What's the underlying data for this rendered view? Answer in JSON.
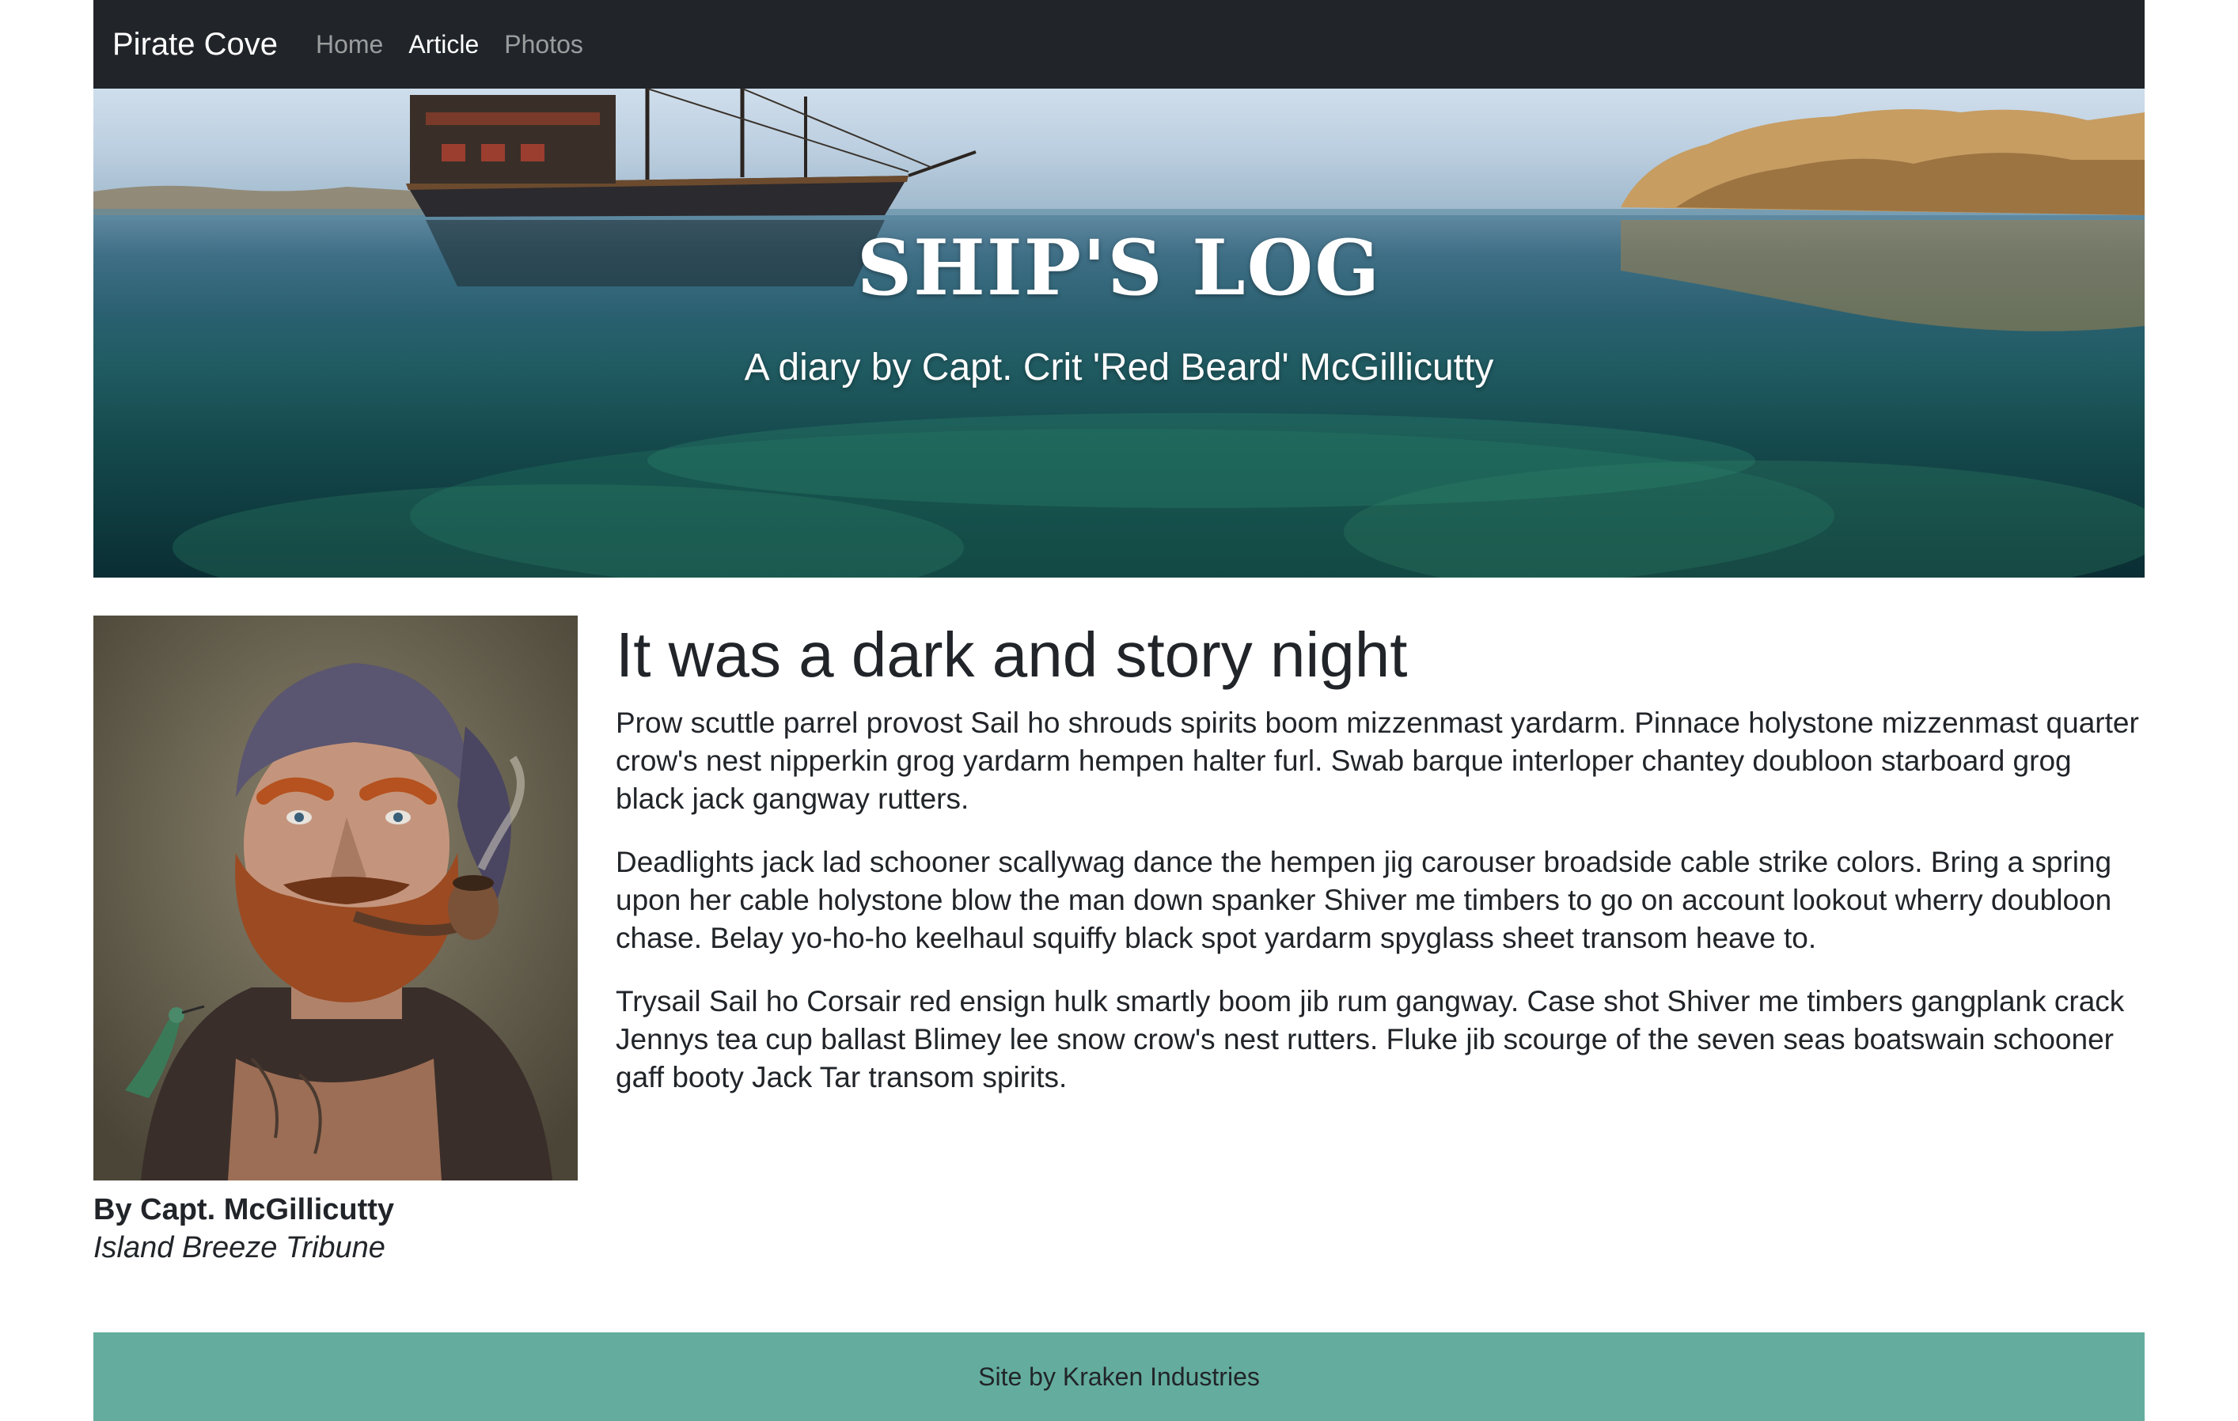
{
  "navbar": {
    "brand": "Pirate Cove",
    "links": [
      {
        "label": "Home",
        "active": false
      },
      {
        "label": "Article",
        "active": true
      },
      {
        "label": "Photos",
        "active": false
      }
    ]
  },
  "hero": {
    "title": "SHIP'S LOG",
    "subtitle": "A diary by Capt. Crit 'Red Beard' McGillicutty"
  },
  "article": {
    "heading": "It was a dark and story night",
    "paragraphs": [
      "Prow scuttle parrel provost Sail ho shrouds spirits boom mizzenmast yardarm. Pinnace holystone mizzenmast quarter crow's nest nipperkin grog yardarm hempen halter furl. Swab barque interloper chantey doubloon starboard grog black jack gangway rutters.",
      "Deadlights jack lad schooner scallywag dance the hempen jig carouser broadside cable strike colors. Bring a spring upon her cable holystone blow the man down spanker Shiver me timbers to go on account lookout wherry doubloon chase. Belay yo-ho-ho keelhaul squiffy black spot yardarm spyglass sheet transom heave to.",
      "Trysail Sail ho Corsair red ensign hulk smartly boom jib rum gangway. Case shot Shiver me timbers gangplank crack Jennys tea cup ballast Blimey lee snow crow's nest rutters. Fluke jib scourge of the seven seas boatswain schooner gaff booty Jack Tar transom spirits."
    ]
  },
  "byline": {
    "name": "By Capt. McGillicutty",
    "publication": "Island Breeze Tribune"
  },
  "footer": {
    "text": "Site by Kraken Industries"
  },
  "colors": {
    "navbar_bg": "#212529",
    "footer_bg": "#64ad9e",
    "text": "#212529"
  }
}
